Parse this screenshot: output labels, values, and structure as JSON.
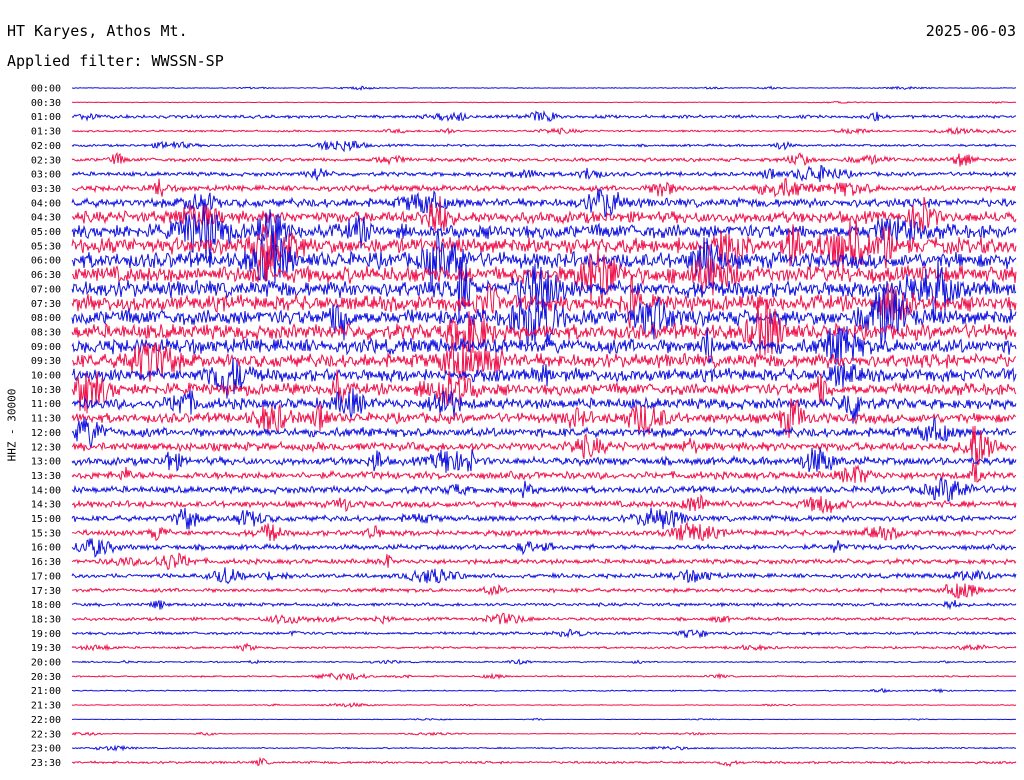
{
  "header": {
    "station": "HT Karyes, Athos Mt.",
    "date": "2025-06-03",
    "filter": "Applied filter: WWSSN-SP"
  },
  "chart_data": {
    "type": "helicorder",
    "ylabel": "HHZ - 30000",
    "row_labels": [
      "00:00",
      "00:30",
      "01:00",
      "01:30",
      "02:00",
      "02:30",
      "03:00",
      "03:30",
      "04:00",
      "04:30",
      "05:00",
      "05:30",
      "06:00",
      "06:30",
      "07:00",
      "07:30",
      "08:00",
      "08:30",
      "09:00",
      "09:30",
      "10:00",
      "10:30",
      "11:00",
      "11:30",
      "12:00",
      "12:30",
      "13:00",
      "13:30",
      "14:00",
      "14:30",
      "15:00",
      "15:30",
      "16:00",
      "16:30",
      "17:00",
      "17:30",
      "18:00",
      "18:30",
      "19:00",
      "19:30",
      "20:00",
      "20:30",
      "21:00",
      "21:30",
      "22:00",
      "22:30",
      "23:00",
      "23:30"
    ],
    "trace_colors": [
      "#1010e0",
      "#f0104a"
    ],
    "color_pattern": "alternating rows blue / red",
    "relative_noise_level": [
      0.3,
      0.25,
      1.2,
      0.7,
      0.9,
      1.4,
      1.6,
      2.2,
      3.4,
      4.6,
      5.6,
      6.2,
      6.3,
      6.4,
      6.4,
      6.2,
      6.1,
      6.0,
      5.8,
      5.4,
      5.0,
      4.6,
      4.2,
      3.9,
      3.6,
      3.3,
      3.1,
      2.9,
      2.7,
      2.5,
      2.3,
      2.2,
      2.0,
      1.9,
      1.7,
      1.5,
      1.3,
      1.2,
      1.1,
      0.8,
      0.55,
      0.55,
      0.45,
      0.3,
      0.2,
      0.3,
      0.5,
      0.9
    ]
  }
}
